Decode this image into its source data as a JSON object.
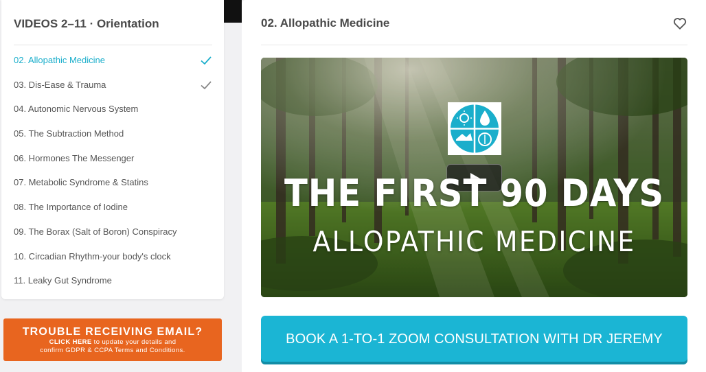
{
  "sidebar": {
    "title": "VIDEOS 2–11 · Orientation",
    "items": [
      {
        "label": "02. Allopathic Medicine",
        "active": true,
        "completed": true
      },
      {
        "label": "03. Dis-Ease & Trauma",
        "active": false,
        "completed": true
      },
      {
        "label": "04. Autonomic Nervous System",
        "active": false,
        "completed": false
      },
      {
        "label": "05. The Subtraction Method",
        "active": false,
        "completed": false
      },
      {
        "label": "06. Hormones The Messenger",
        "active": false,
        "completed": false
      },
      {
        "label": "07. Metabolic Syndrome & Statins",
        "active": false,
        "completed": false
      },
      {
        "label": "08. The Importance of Iodine",
        "active": false,
        "completed": false
      },
      {
        "label": "09. The Borax (Salt of Boron) Conspiracy",
        "active": false,
        "completed": false
      },
      {
        "label": "10. Circadian Rhythm-your body's clock",
        "active": false,
        "completed": false
      },
      {
        "label": "11. Leaky Gut Syndrome",
        "active": false,
        "completed": false
      }
    ]
  },
  "email_banner": {
    "headline": "TROUBLE RECEIVING EMAIL?",
    "click_here": "CLICK HERE",
    "line1_rest": " to update your details and",
    "line2": "confirm GDPR & CCPA Terms and Conditions."
  },
  "main": {
    "title": "02. Allopathic Medicine",
    "favorite_icon": "heart-icon",
    "video": {
      "title_line1": "THE FIRST 90 DAYS",
      "title_line2": "ALLOPATHIC MEDICINE",
      "play_icon": "play-icon"
    },
    "book_button": "BOOK A 1-TO-1 ZOOM CONSULTATION WITH DR JEREMY"
  },
  "colors": {
    "accent": "#1aaecb",
    "button": "#1bb5d4",
    "banner": "#e8651f",
    "check_done": "#888888"
  }
}
